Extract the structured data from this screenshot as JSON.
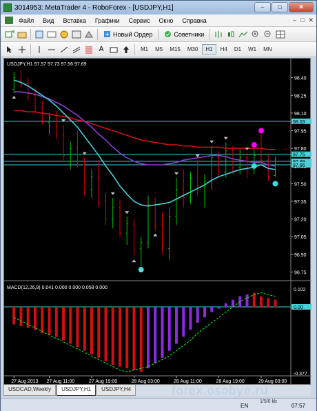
{
  "window": {
    "title": "3014953: MetaTrader 4 - RoboForex - [USDJPY,H1]",
    "controls": [
      "–",
      "□",
      "✕"
    ]
  },
  "menu": [
    "Файл",
    "Вид",
    "Вставка",
    "Графики",
    "Сервис",
    "Окно",
    "Справка"
  ],
  "mdi_controls": [
    "–",
    "□",
    "✕"
  ],
  "toolbar": {
    "new_order_label": "Новый Ордер",
    "advisors_label": "Советники"
  },
  "timeframes": [
    "M1",
    "M5",
    "M15",
    "M30",
    "H1",
    "H4",
    "D1",
    "W1",
    "MN"
  ],
  "active_timeframe": "H1",
  "colors": {
    "background": "#000000",
    "bull": "#00c000",
    "bear": "#e00000",
    "ma_fast": "#4ad0d8",
    "ma_mid": "#8a3fd0",
    "ma_slow": "#d01010",
    "macd_neg": "#d01010",
    "macd_pos": "#8a2be2",
    "signal": "#00ff00",
    "level": "#4ad0d8",
    "dot_up": "#ff00ff",
    "dot_down": "#30e0e8"
  },
  "chart_data": {
    "type": "candlestick",
    "title": "USDJPY,H1 97.57 97.73 97.56 97.69",
    "price_axis": [
      "98.40",
      "98.25",
      "98.10",
      "97.95",
      "97.80",
      "97.65",
      "97.50",
      "97.35",
      "97.20",
      "97.05",
      "96.90",
      "96.75"
    ],
    "ylim": [
      96.7,
      98.48
    ],
    "level_labels": [
      "98.03",
      "97.75",
      "97.69",
      "97.66"
    ],
    "levels": [
      98.03,
      97.75,
      97.69,
      97.66
    ],
    "time_axis": [
      "27 Aug 2013",
      "27 Aug 11:00",
      "27 Aug 19:00",
      "28 Aug 03:00",
      "28 Aug 11:00",
      "28 Aug 19:00",
      "29 Aug 03:00"
    ],
    "candles": [
      [
        98.3,
        98.45,
        98.27,
        98.4
      ],
      [
        98.38,
        98.46,
        98.32,
        98.34
      ],
      [
        98.35,
        98.4,
        98.2,
        98.24
      ],
      [
        98.25,
        98.32,
        98.1,
        98.14
      ],
      [
        98.15,
        98.2,
        98.0,
        98.02
      ],
      [
        98.02,
        98.1,
        97.92,
        98.06
      ],
      [
        98.05,
        98.12,
        97.88,
        97.92
      ],
      [
        97.92,
        98.0,
        97.7,
        97.74
      ],
      [
        97.75,
        97.86,
        97.62,
        97.8
      ],
      [
        97.8,
        97.95,
        97.64,
        97.66
      ],
      [
        97.66,
        97.72,
        97.4,
        97.44
      ],
      [
        97.45,
        97.62,
        97.38,
        97.56
      ],
      [
        97.55,
        97.7,
        97.3,
        97.34
      ],
      [
        97.35,
        97.42,
        97.15,
        97.2
      ],
      [
        97.2,
        97.38,
        97.12,
        97.3
      ],
      [
        97.3,
        97.36,
        97.05,
        97.08
      ],
      [
        97.08,
        97.22,
        96.98,
        97.16
      ],
      [
        97.15,
        97.2,
        96.88,
        96.94
      ],
      [
        96.95,
        97.05,
        96.8,
        97.0
      ],
      [
        97.0,
        97.4,
        96.95,
        97.32
      ],
      [
        97.32,
        97.38,
        97.1,
        97.14
      ],
      [
        97.15,
        97.25,
        96.9,
        96.96
      ],
      [
        96.95,
        97.3,
        96.85,
        97.22
      ],
      [
        97.22,
        97.55,
        97.15,
        97.45
      ],
      [
        97.45,
        97.62,
        97.3,
        97.38
      ],
      [
        97.38,
        97.6,
        97.33,
        97.55
      ],
      [
        97.55,
        97.7,
        97.4,
        97.48
      ],
      [
        97.48,
        97.58,
        97.3,
        97.52
      ],
      [
        97.52,
        97.82,
        97.45,
        97.72
      ],
      [
        97.72,
        97.78,
        97.55,
        97.6
      ],
      [
        97.6,
        97.85,
        97.55,
        97.78
      ],
      [
        97.78,
        97.82,
        97.58,
        97.64
      ],
      [
        97.64,
        97.8,
        97.58,
        97.72
      ],
      [
        97.72,
        97.76,
        97.55,
        97.62
      ],
      [
        97.62,
        97.8,
        97.58,
        97.74
      ],
      [
        97.74,
        97.92,
        97.66,
        97.7
      ],
      [
        97.7,
        97.75,
        97.52,
        97.56
      ],
      [
        97.57,
        97.73,
        97.56,
        97.69
      ]
    ],
    "ma_fast": [
      98.38,
      98.36,
      98.33,
      98.29,
      98.25,
      98.21,
      98.16,
      98.1,
      98.04,
      97.98,
      97.9,
      97.82,
      97.74,
      97.65,
      97.57,
      97.48,
      97.41,
      97.35,
      97.32,
      97.31,
      97.32,
      97.33,
      97.34,
      97.37,
      97.4,
      97.43,
      97.46,
      97.49,
      97.53,
      97.56,
      97.58,
      97.6,
      97.62,
      97.63,
      97.64,
      97.66,
      97.63,
      97.62
    ],
    "ma_mid": [
      98.28,
      98.28,
      98.27,
      98.26,
      98.24,
      98.22,
      98.19,
      98.16,
      98.12,
      98.08,
      98.03,
      97.98,
      97.92,
      97.87,
      97.81,
      97.76,
      97.72,
      97.69,
      97.67,
      97.66,
      97.66,
      97.66,
      97.67,
      97.68,
      97.7,
      97.71,
      97.72,
      97.73,
      97.74,
      97.74,
      97.73,
      97.71,
      97.7,
      97.69,
      97.68,
      97.68,
      97.66,
      97.65
    ],
    "ma_slow": [
      98.12,
      98.12,
      98.11,
      98.11,
      98.1,
      98.09,
      98.08,
      98.07,
      98.06,
      98.04,
      98.03,
      98.01,
      97.99,
      97.97,
      97.95,
      97.93,
      97.91,
      97.89,
      97.87,
      97.86,
      97.85,
      97.84,
      97.83,
      97.83,
      97.82,
      97.82,
      97.81,
      97.81,
      97.81,
      97.81,
      97.8,
      97.8,
      97.8,
      97.8,
      97.8,
      97.8,
      97.79,
      97.79
    ],
    "dots_up": [
      [
        35,
        97.95
      ],
      [
        34,
        97.83
      ]
    ],
    "dots_down": [
      [
        18,
        96.77
      ],
      [
        34,
        97.65
      ],
      [
        37,
        97.5
      ]
    ],
    "arrows_up": [
      0,
      18,
      17,
      20
    ],
    "arrows_down": [
      7,
      10,
      14,
      16,
      23,
      26,
      28,
      30,
      33
    ],
    "macd": {
      "label": "MACD(12,26,9) 0.041 0.000 0.000 0.058 0.000",
      "axis": [
        "0.102",
        "0.00",
        "-0.377"
      ],
      "ylim": [
        -0.377,
        0.102
      ],
      "hist": [
        -0.1,
        -0.11,
        -0.12,
        -0.13,
        -0.15,
        -0.16,
        -0.17,
        -0.19,
        -0.21,
        -0.23,
        -0.25,
        -0.27,
        -0.29,
        -0.31,
        -0.33,
        -0.34,
        -0.35,
        -0.36,
        -0.37,
        -0.35,
        -0.32,
        -0.29,
        -0.25,
        -0.21,
        -0.17,
        -0.13,
        -0.09,
        -0.06,
        -0.03,
        -0.01,
        0.02,
        0.04,
        0.06,
        0.07,
        0.08,
        0.06,
        0.05,
        0.04
      ],
      "signal": [
        -0.06,
        -0.08,
        -0.1,
        -0.12,
        -0.14,
        -0.16,
        -0.18,
        -0.2,
        -0.22,
        -0.24,
        -0.26,
        -0.28,
        -0.3,
        -0.32,
        -0.34,
        -0.36,
        -0.37,
        -0.36,
        -0.35,
        -0.34,
        -0.32,
        -0.3,
        -0.28,
        -0.25,
        -0.22,
        -0.19,
        -0.15,
        -0.12,
        -0.09,
        -0.06,
        -0.03,
        0.0,
        0.03,
        0.05,
        0.07,
        0.08,
        0.07,
        0.06
      ]
    }
  },
  "tabs": [
    {
      "label": "USDCAD,Weekly",
      "active": false
    },
    {
      "label": "USDJPY,H1",
      "active": true
    },
    {
      "label": "USDJPY,H4",
      "active": false
    }
  ],
  "status": {
    "rate": "1/5/0 kb",
    "lang": "EN",
    "clock": "07:57"
  },
  "watermark": "forex.osobye.ru"
}
